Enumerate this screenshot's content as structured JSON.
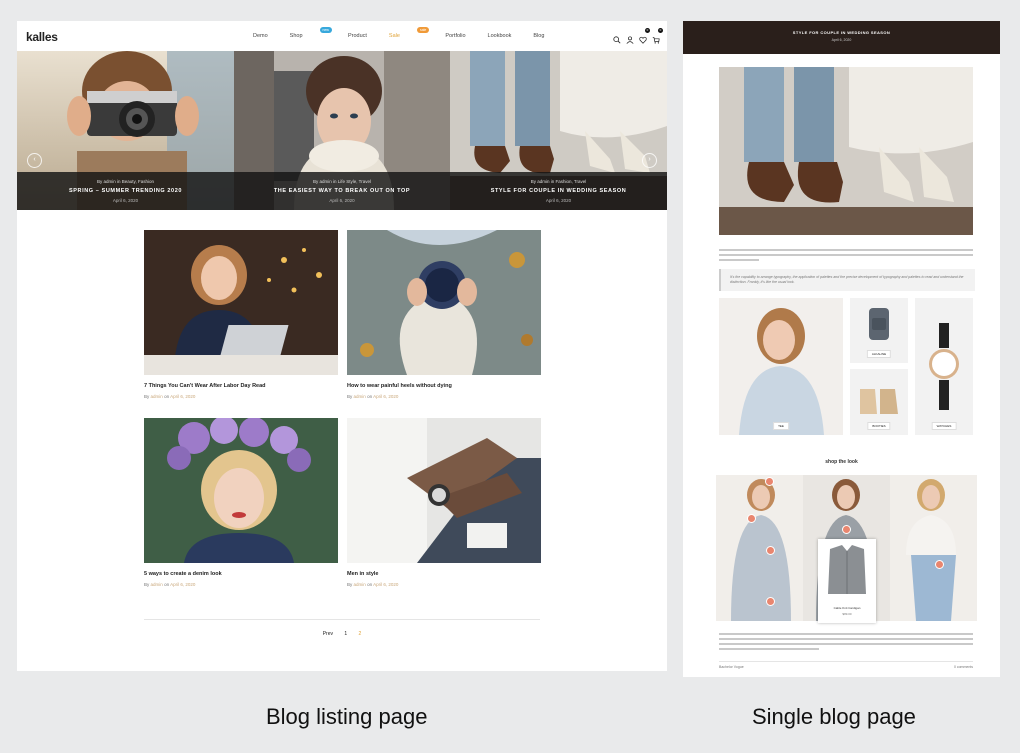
{
  "captions": {
    "left": "Blog listing page",
    "right": "Single blog page"
  },
  "listing": {
    "logo": "kalles",
    "nav": [
      {
        "label": "Demo",
        "badge": ""
      },
      {
        "label": "Shop",
        "badge": "new"
      },
      {
        "label": "Product",
        "badge": ""
      },
      {
        "label": "Sale",
        "badge": "sale"
      },
      {
        "label": "Portfolio",
        "badge": ""
      },
      {
        "label": "Lookbook",
        "badge": ""
      },
      {
        "label": "Blog",
        "badge": ""
      }
    ],
    "icons": [
      "search-icon",
      "user-icon",
      "heart-icon",
      "cart-icon"
    ],
    "wishlist_count": "0",
    "cart_count": "0",
    "slides": [
      {
        "category": "By admin  in  Beauty, Fashion",
        "title": "SPRING – SUMMER TRENDING 2020",
        "date": "April 6, 2020"
      },
      {
        "category": "By admin  in  Life Style, Travel",
        "title": "THE EASIEST WAY TO BREAK OUT ON TOP",
        "date": "April 6, 2020"
      },
      {
        "category": "By admin  in  Fashion, Travel",
        "title": "STYLE FOR COUPLE IN WEDDING SEASON",
        "date": "April 6, 2020"
      }
    ],
    "posts": [
      {
        "title": "7 Things You Can't Wear After Labor Day Read",
        "by": "By",
        "author": "admin",
        "on": "on",
        "date": "April 6, 2020"
      },
      {
        "title": "How to wear painful heels without dying",
        "by": "By",
        "author": "admin",
        "on": "on",
        "date": "April 6, 2020"
      },
      {
        "title": "5 ways to create a denim look",
        "by": "By",
        "author": "admin",
        "on": "on",
        "date": "April 6, 2020"
      },
      {
        "title": "Men in style",
        "by": "By",
        "author": "admin",
        "on": "on",
        "date": "April 6, 2020"
      }
    ],
    "pagination": {
      "prev": "Prev",
      "pages": [
        "1",
        "2"
      ],
      "active": "2"
    }
  },
  "single": {
    "header_title": "STYLE FOR COUPLE IN WEDDING SEASON",
    "header_date": "April 6, 2020",
    "quote": "It's the capability to arrange typography, the application of palettes and the precise development of typography and palettes to read and understand the distinction. Frankly, it's like the usual look.",
    "products": [
      "ALKALINE",
      "BOOTIES",
      "WATCHES",
      "TEE"
    ],
    "shop_title": "shop the look",
    "popup_name": "Cable Knit Cardigan",
    "popup_price": "$89.00",
    "footer_left": "Bachelor Vogue",
    "footer_right": "0 comments"
  },
  "colors": {
    "accent": "#e0a43a",
    "hotspot": "#e9866f",
    "dark_header": "#2a1f1b"
  }
}
